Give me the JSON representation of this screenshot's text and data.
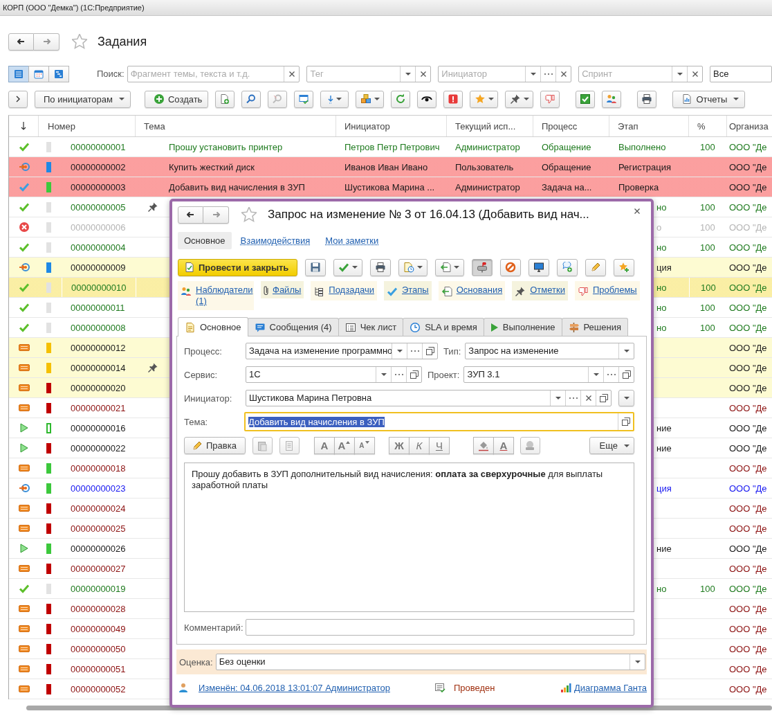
{
  "window": {
    "title": "КОРП (ООО \"Демка\")  (1С:Предприятие)"
  },
  "page": {
    "title": "Задания",
    "favorite": false
  },
  "view_modes": [
    {
      "selected": true
    },
    {
      "selected": false
    },
    {
      "selected": false
    }
  ],
  "search": {
    "label": "Поиск:",
    "placeholder": "Фрагмент темы, текста и т.д."
  },
  "filters": [
    {
      "placeholder": "Тег",
      "kind": "tag"
    },
    {
      "placeholder": "Инициатор",
      "kind": "lookup"
    },
    {
      "placeholder": "Спринт",
      "kind": "tag"
    },
    {
      "value": "Все",
      "kind": "value"
    }
  ],
  "toolbar": {
    "group_button": "По инициаторам",
    "create_button": "Создать",
    "reports_button": "Отчеты"
  },
  "table": {
    "columns": [
      "Номер",
      "Тема",
      "Инициатор",
      "Текущий исп...",
      "Процесс",
      "Этап",
      "%",
      "Организа"
    ],
    "rows": [
      {
        "status": {
          "kind": "done"
        },
        "marker": {
          "color": "#e2e2e2",
          "kind": "solid"
        },
        "number": "00000000001",
        "color": "#1e7a1e",
        "alert": false,
        "attention": false,
        "selected": false,
        "pinned": false,
        "tema": "Прошу установить принтер",
        "initiator": "Петров Петр Петрович",
        "executor": "Администратор",
        "process": "Обращение",
        "etap": "Выполнено",
        "percent": "100",
        "org": "ООО \"Де"
      },
      {
        "status": {
          "kind": "returned"
        },
        "marker": {
          "color": "#1e88e5",
          "kind": "solid"
        },
        "number": "00000000002",
        "color": "#1a1a1a",
        "alert": true,
        "attention": false,
        "selected": false,
        "pinned": false,
        "tema": "Купить жесткий диск",
        "initiator": "Иванов Иван Ивано",
        "executor": "Пользователь",
        "process": "Обращение",
        "etap": "Регистрация",
        "org": "ООО \"Де"
      },
      {
        "status": {
          "kind": "checked"
        },
        "marker": {
          "color": "#3cc83c",
          "kind": "solid"
        },
        "number": "00000000003",
        "color": "#1a1a1a",
        "alert": true,
        "attention": false,
        "selected": false,
        "pinned": false,
        "tema": "Добавить вид начисления в ЗУП",
        "initiator": "Шустикова Марина ...",
        "executor": "Администратор",
        "process": "Задача на...",
        "etap": "Проверка",
        "org": "ООО \"Де"
      },
      {
        "status": {
          "kind": "done"
        },
        "marker": {
          "color": "#e2e2e2",
          "kind": "solid"
        },
        "number": "00000000005",
        "color": "#1e7a1e",
        "alert": false,
        "attention": false,
        "selected": false,
        "pinned": true,
        "etap": "но",
        "percent": "100",
        "org": "ООО \"Де"
      },
      {
        "status": {
          "kind": "error"
        },
        "marker": {
          "color": "#e2e2e2",
          "kind": "solid"
        },
        "number": "00000000006",
        "color": "#b4b4b4",
        "alert": false,
        "attention": false,
        "selected": false,
        "pinned": false,
        "etap": "о",
        "percent": "100",
        "org": "ООО \"Де"
      },
      {
        "status": {
          "kind": "done"
        },
        "marker": {
          "color": "#e2e2e2",
          "kind": "solid"
        },
        "number": "00000000004",
        "color": "#1e7a1e",
        "alert": false,
        "attention": false,
        "selected": false,
        "pinned": false,
        "etap": "но",
        "percent": "100",
        "org": "ООО \"Де"
      },
      {
        "status": {
          "kind": "returned"
        },
        "marker": {
          "color": "#1e88e5",
          "kind": "solid"
        },
        "number": "00000000009",
        "color": "#1a1a1a",
        "alert": false,
        "attention": true,
        "selected": false,
        "pinned": false,
        "etap": "ция",
        "org": "ООО \"Де"
      },
      {
        "status": {
          "kind": "done"
        },
        "marker": {
          "color": "#e2e2e2",
          "kind": "solid"
        },
        "number": "00000000010",
        "color": "#1e7a1e",
        "alert": false,
        "attention": true,
        "selected": true,
        "pinned": false,
        "etap": "но",
        "percent": "100",
        "org": "ООО \"Де"
      },
      {
        "status": {
          "kind": "done"
        },
        "marker": {
          "color": "#e2e2e2",
          "kind": "solid"
        },
        "number": "00000000011",
        "color": "#1e7a1e",
        "alert": false,
        "attention": false,
        "selected": false,
        "pinned": false,
        "etap": "но",
        "percent": "100",
        "org": "ООО \"Де"
      },
      {
        "status": {
          "kind": "done"
        },
        "marker": {
          "color": "#e2e2e2",
          "kind": "solid"
        },
        "number": "00000000008",
        "color": "#1e7a1e",
        "alert": false,
        "attention": false,
        "selected": false,
        "pinned": false,
        "etap": "но",
        "percent": "100",
        "org": "ООО \"Де"
      },
      {
        "status": {
          "kind": "new"
        },
        "marker": {
          "color": "#f5c000",
          "kind": "solid"
        },
        "number": "00000000012",
        "color": "#1a1a1a",
        "alert": false,
        "attention": true,
        "selected": false,
        "pinned": false,
        "org": "ООО \"Де"
      },
      {
        "status": {
          "kind": "new"
        },
        "marker": {
          "color": "#f5c000",
          "kind": "solid"
        },
        "number": "00000000014",
        "color": "#1a1a1a",
        "alert": false,
        "attention": true,
        "selected": false,
        "pinned": true,
        "org": "ООО \"Де"
      },
      {
        "status": {
          "kind": "new"
        },
        "marker": {
          "color": "#c00000",
          "kind": "solid"
        },
        "number": "00000000020",
        "color": "#1a1a1a",
        "alert": false,
        "attention": true,
        "selected": false,
        "pinned": false,
        "org": "ООО \"Де"
      },
      {
        "status": {
          "kind": "new"
        },
        "marker": {
          "color": "#c00000",
          "kind": "solid"
        },
        "number": "00000000021",
        "color": "#8b1010",
        "alert": false,
        "attention": false,
        "selected": false,
        "pinned": false,
        "org": "ООО \"Де"
      },
      {
        "status": {
          "kind": "running"
        },
        "marker": {
          "color": "#2eb82e",
          "kind": "outline"
        },
        "number": "00000000016",
        "color": "#1a1a1a",
        "alert": false,
        "attention": false,
        "selected": false,
        "pinned": false,
        "etap": "ние",
        "org": "ООО \"Де"
      },
      {
        "status": {
          "kind": "running"
        },
        "marker": {
          "color": "#c00000",
          "kind": "solid"
        },
        "number": "00000000022",
        "color": "#1a1a1a",
        "alert": false,
        "attention": false,
        "selected": false,
        "pinned": false,
        "etap": "ние",
        "org": "ООО \"Де"
      },
      {
        "status": {
          "kind": "new"
        },
        "marker": {
          "color": "#3cc83c",
          "kind": "solid"
        },
        "number": "00000000018",
        "color": "#8b1010",
        "alert": false,
        "attention": false,
        "selected": false,
        "pinned": false,
        "org": "ООО \"Де"
      },
      {
        "status": {
          "kind": "returned"
        },
        "marker": {
          "color": "#3cc83c",
          "kind": "solid"
        },
        "number": "00000000023",
        "color": "#1515f0",
        "alert": false,
        "attention": false,
        "selected": false,
        "pinned": false,
        "etap": "ция",
        "org": "ООО \"Де"
      },
      {
        "status": {
          "kind": "new"
        },
        "marker": {
          "color": "#c00000",
          "kind": "solid"
        },
        "number": "00000000024",
        "color": "#8b1010",
        "alert": false,
        "attention": false,
        "selected": false,
        "pinned": false,
        "org": "ООО \"Де"
      },
      {
        "status": {
          "kind": "new"
        },
        "marker": {
          "color": "#c00000",
          "kind": "solid"
        },
        "number": "00000000025",
        "color": "#8b1010",
        "alert": false,
        "attention": false,
        "selected": false,
        "pinned": false,
        "org": "ООО \"Де"
      },
      {
        "status": {
          "kind": "running"
        },
        "marker": {
          "color": "#3cc83c",
          "kind": "solid"
        },
        "number": "00000000026",
        "color": "#1a1a1a",
        "alert": false,
        "attention": false,
        "selected": false,
        "pinned": false,
        "etap": "ние",
        "org": "ООО \"Де"
      },
      {
        "status": {
          "kind": "new"
        },
        "marker": {
          "color": "#c00000",
          "kind": "solid"
        },
        "number": "00000000027",
        "color": "#8b1010",
        "alert": false,
        "attention": false,
        "selected": false,
        "pinned": false,
        "org": "ООО \"Де"
      },
      {
        "status": {
          "kind": "done"
        },
        "marker": {
          "color": "#e2e2e2",
          "kind": "solid"
        },
        "number": "00000000019",
        "color": "#1e7a1e",
        "alert": false,
        "attention": false,
        "selected": false,
        "pinned": false,
        "etap": "но",
        "percent": "100",
        "org": "ООО \"Де"
      },
      {
        "status": {
          "kind": "new"
        },
        "marker": {
          "color": "#c00000",
          "kind": "solid"
        },
        "number": "00000000028",
        "color": "#8b1010",
        "alert": false,
        "attention": false,
        "selected": false,
        "pinned": false,
        "org": "ООО \"Де"
      },
      {
        "status": {
          "kind": "new"
        },
        "marker": {
          "color": "#c00000",
          "kind": "solid"
        },
        "number": "00000000049",
        "color": "#8b1010",
        "alert": false,
        "attention": false,
        "selected": false,
        "pinned": false,
        "org": "ООО \"Де"
      },
      {
        "status": {
          "kind": "new"
        },
        "marker": {
          "color": "#c00000",
          "kind": "solid"
        },
        "number": "00000000050",
        "color": "#8b1010",
        "alert": false,
        "attention": false,
        "selected": false,
        "pinned": false,
        "org": "ООО \"Де"
      },
      {
        "status": {
          "kind": "new"
        },
        "marker": {
          "color": "#c00000",
          "kind": "solid"
        },
        "number": "00000000051",
        "color": "#8b1010",
        "alert": false,
        "attention": false,
        "selected": false,
        "pinned": false,
        "org": "ООО \"Де"
      },
      {
        "status": {
          "kind": "new"
        },
        "marker": {
          "color": "#c00000",
          "kind": "solid"
        },
        "number": "00000000052",
        "color": "#8b1010",
        "alert": false,
        "attention": false,
        "selected": false,
        "pinned": false,
        "org": "ООО \"Де"
      }
    ]
  },
  "dialog": {
    "title": "Запрос на изменение № 3 от 16.04.13 (Добавить вид нач...",
    "favorite": false,
    "sections": [
      {
        "label": "Основное",
        "selected": true
      },
      {
        "label": "Взаимодействия",
        "selected": false
      },
      {
        "label": "Мои заметки",
        "selected": false
      }
    ],
    "post_button": "Провести и закрыть",
    "command_buttons": [
      {
        "pressed": false
      },
      {
        "pressed": false
      },
      {
        "pressed": false
      },
      {
        "pressed": false
      },
      {
        "pressed": false
      },
      {
        "pressed": true
      },
      {
        "pressed": false
      },
      {
        "pressed": false
      },
      {
        "pressed": false
      },
      {
        "pressed": false
      },
      {
        "pressed": false
      }
    ],
    "links": [
      "Наблюдатели (1)",
      "Файлы",
      "Подзадачи",
      "Этапы",
      "Основания",
      "Отметки",
      "Проблемы"
    ],
    "tabs": [
      {
        "label": "Основное",
        "selected": true
      },
      {
        "label": "Сообщения (4)",
        "selected": false
      },
      {
        "label": "Чек лист",
        "selected": false
      },
      {
        "label": "SLA и время",
        "selected": false
      },
      {
        "label": "Выполнение",
        "selected": false
      },
      {
        "label": "Решения",
        "selected": false
      }
    ],
    "fields": {
      "process": {
        "label": "Процесс:",
        "value": "Задача на изменение программно"
      },
      "type": {
        "label": "Тип:",
        "value": "Запрос на изменение"
      },
      "service": {
        "label": "Сервис:",
        "value": "1С"
      },
      "project": {
        "label": "Проект:",
        "value": "ЗУП 3.1"
      },
      "initiator": {
        "label": "Инициатор:",
        "value": "Шустикова Марина Петровна"
      },
      "subject": {
        "label": "Тема:",
        "value": "Добавить вид начисления в ЗУП",
        "focused": true,
        "text_selected": true
      }
    },
    "editor": {
      "edit_button": "Правка",
      "font_buttons": [
        {
          "label": "А",
          "kind": "normal"
        },
        {
          "label": "А",
          "kind": "grow"
        },
        {
          "label": "А",
          "kind": "shrink"
        }
      ],
      "style_buttons": [
        {
          "label": "Ж",
          "kind": "bold"
        },
        {
          "label": "К",
          "kind": "italic"
        },
        {
          "label": "Ч",
          "kind": "underline"
        }
      ],
      "color_button": "А",
      "more_button": "Еще",
      "text": "Прошу добавить в ЗУП дополнительный вид начисления: **оплата за сверхурочные** для выплаты заработной платы"
    },
    "comment": {
      "label": "Комментарий:"
    },
    "rating": {
      "label": "Оценка:",
      "value": "Без оценки"
    },
    "footer": {
      "changed_link": "Изменён: 04.06.2018 13:01:07 Администратор",
      "status": "Проведен",
      "gantt_link": "Диаграмма Ганта"
    }
  }
}
